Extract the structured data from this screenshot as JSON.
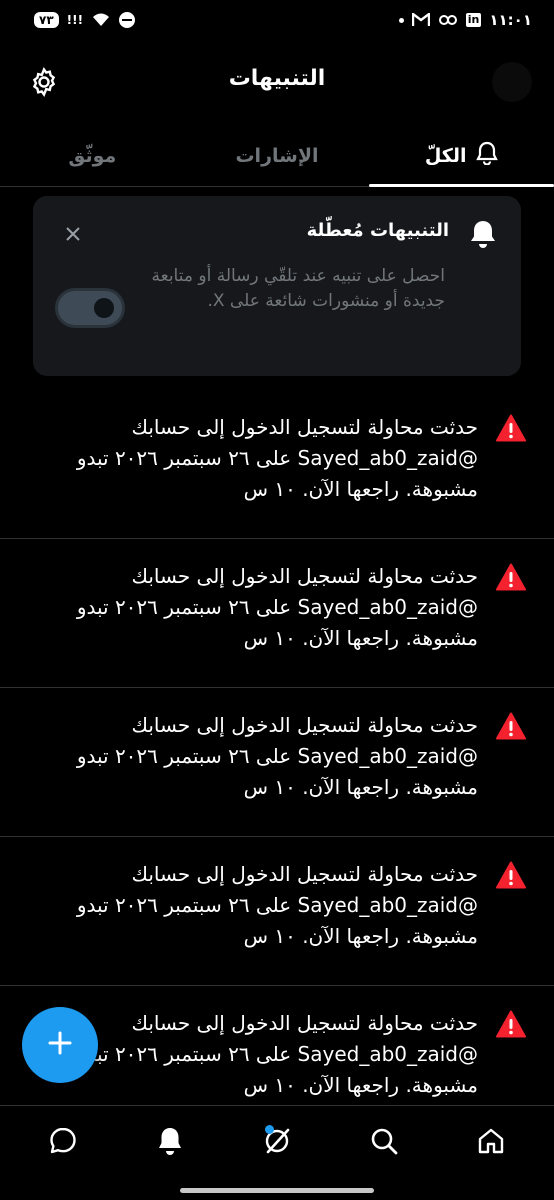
{
  "status_bar": {
    "time": "١١:٠١",
    "battery": "٧٣",
    "signal_text": "!!!",
    "right_icons": [
      "gmail-icon",
      "connect-icon",
      "linkedin-icon"
    ],
    "linkedin_label": "in"
  },
  "header": {
    "title": "التنبيهات"
  },
  "tabs": [
    {
      "label": "الكلّ",
      "active": true
    },
    {
      "label": "الإشارات",
      "active": false
    },
    {
      "label": "موثّق",
      "active": false
    }
  ],
  "notice_card": {
    "title": "التنبيهات مُعطّلة",
    "description": "احصل على تنبيه عند تلقّي رسالة أو متابعة جديدة أو منشورات شائعة على X.",
    "toggle_state": "off"
  },
  "notifications": [
    {
      "text": "حدثت محاولة لتسجيل الدخول إلى حسابك @Sayed_ab0_zaid على ٢٦ سبتمبر ٢٠٢٦ تبدو مشبوهة. راجعها الآن.",
      "time": "١٠ س"
    },
    {
      "text": "حدثت محاولة لتسجيل الدخول إلى حسابك @Sayed_ab0_zaid على ٢٦ سبتمبر ٢٠٢٦ تبدو مشبوهة. راجعها الآن.",
      "time": "١٠ س"
    },
    {
      "text": "حدثت محاولة لتسجيل الدخول إلى حسابك @Sayed_ab0_zaid على ٢٦ سبتمبر ٢٠٢٦ تبدو مشبوهة. راجعها الآن.",
      "time": "١٠ س"
    },
    {
      "text": "حدثت محاولة لتسجيل الدخول إلى حسابك @Sayed_ab0_zaid على ٢٦ سبتمبر ٢٠٢٦ تبدو مشبوهة. راجعها الآن.",
      "time": "١٠ س"
    },
    {
      "text": "حدثت محاولة لتسجيل الدخول إلى حسابك @Sayed_ab0_zaid على ٢٦ سبتمبر ٢٠٢٦ تبدو مشبوهة. راجعها الآن.",
      "time": "١٠ س"
    }
  ],
  "bottom_nav": [
    "messages-icon",
    "notifications-icon",
    "grok-icon",
    "search-icon",
    "home-icon"
  ],
  "colors": {
    "accent": "#1d9bf0",
    "warning": "#f4212e",
    "muted_text": "#71767b",
    "card_bg": "#16181c"
  }
}
